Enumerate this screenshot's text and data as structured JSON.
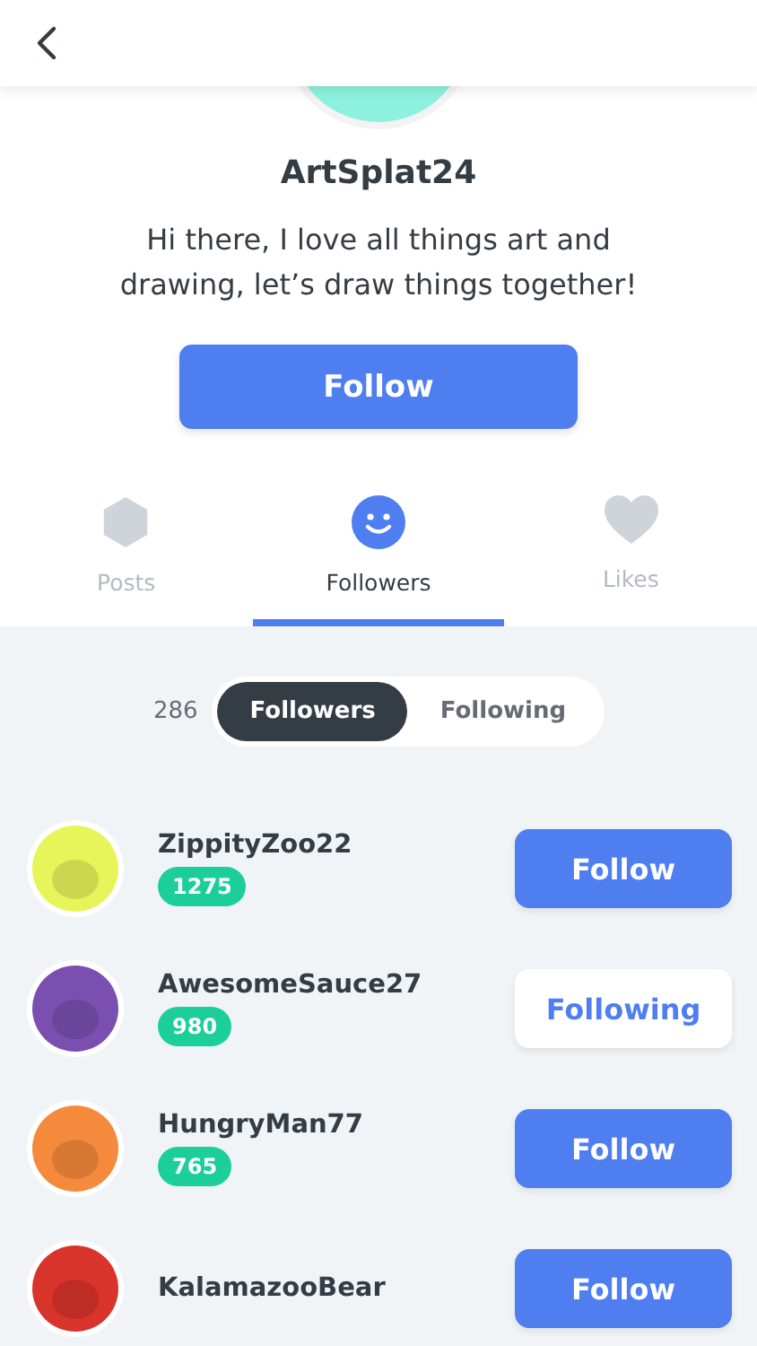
{
  "profile": {
    "username": "ArtSplat24",
    "bio": "Hi there, I love all things art and drawing, let’s draw things together!",
    "follow_button": "Follow"
  },
  "tabs": [
    {
      "label": "Posts",
      "selected": false
    },
    {
      "label": "Followers",
      "selected": true
    },
    {
      "label": "Likes",
      "selected": false
    }
  ],
  "list_switch": {
    "count": "286",
    "options": [
      {
        "label": "Followers",
        "selected": true
      },
      {
        "label": "Following",
        "selected": false
      }
    ]
  },
  "users": [
    {
      "name": "ZippityZoo22",
      "score": "1275",
      "button": "Follow",
      "following": false
    },
    {
      "name": "AwesomeSauce27",
      "score": "980",
      "button": "Following",
      "following": true
    },
    {
      "name": "HungryMan77",
      "score": "765",
      "button": "Follow",
      "following": false
    },
    {
      "name": "KalamazooBear",
      "button": "Follow",
      "following": false
    }
  ]
}
